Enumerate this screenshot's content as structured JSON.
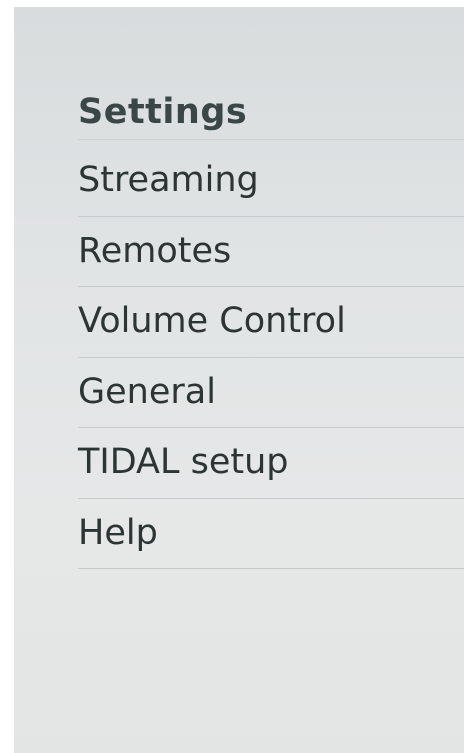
{
  "header": {
    "title": "Settings"
  },
  "menu": {
    "items": [
      {
        "label": "Streaming"
      },
      {
        "label": "Remotes"
      },
      {
        "label": "Volume Control"
      },
      {
        "label": "General"
      },
      {
        "label": "TIDAL setup"
      },
      {
        "label": "Help"
      }
    ]
  },
  "colors": {
    "background": "#e3e6e6",
    "title_text": "#3b4746",
    "item_text": "#2d3534",
    "divider": "#c6cbcb"
  }
}
